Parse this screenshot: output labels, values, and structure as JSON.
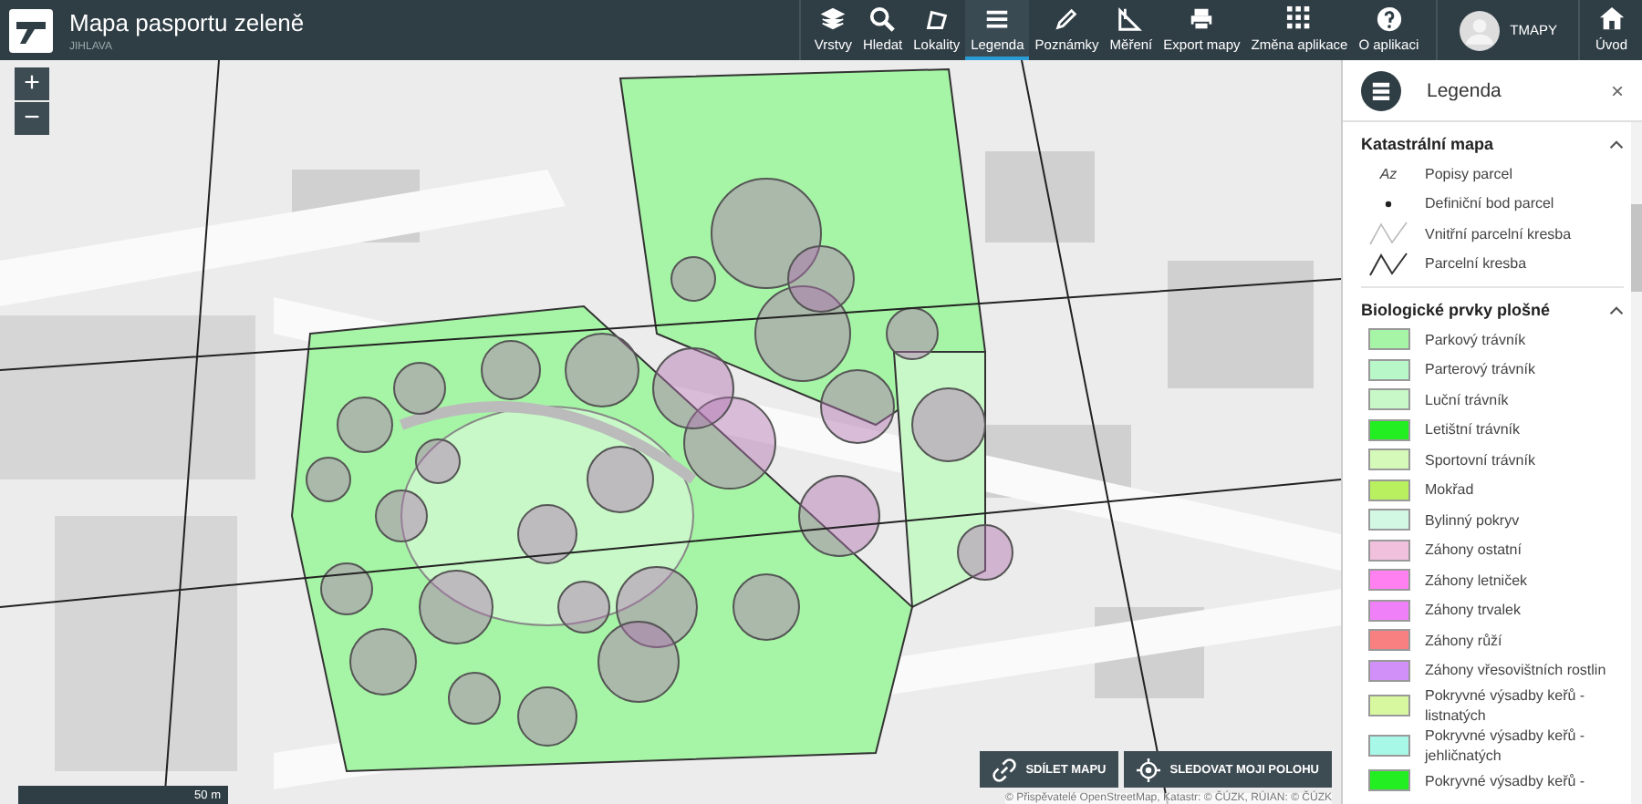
{
  "header": {
    "title": "Mapa pasportu zeleně",
    "subtitle": "JIHLAVA"
  },
  "toolbar": [
    {
      "label": "Vrstvy",
      "selected": false
    },
    {
      "label": "Hledat",
      "selected": false
    },
    {
      "label": "Lokality",
      "selected": false
    },
    {
      "label": "Legenda",
      "selected": true
    },
    {
      "label": "Poznámky",
      "selected": false
    },
    {
      "label": "Měření",
      "selected": false
    },
    {
      "label": "Export mapy",
      "selected": false
    },
    {
      "label": "Změna aplikace",
      "selected": false
    },
    {
      "label": "O aplikaci",
      "selected": false
    }
  ],
  "user": {
    "name": "TMAPY"
  },
  "home": {
    "label": "Úvod"
  },
  "map": {
    "zoom_in": "+",
    "zoom_out": "−",
    "scale": "50 m",
    "share_button": "SDÍLET MAPU",
    "locate_button": "SLEDOVAT MOJI POLOHU",
    "attribution": "© Přispěvatelé OpenStreetMap, Katastr: © ČÚZK, RÚIAN: © ČÚZK"
  },
  "legend": {
    "title": "Legenda",
    "close": "×",
    "sections": [
      {
        "title": "Katastrální mapa",
        "expanded": true,
        "items": [
          {
            "kind": "text",
            "symbol": "Az",
            "label": "Popisy parcel"
          },
          {
            "kind": "dot",
            "label": "Definiční bod parcel"
          },
          {
            "kind": "thin-line",
            "label": "Vnitřní parcelní kresba"
          },
          {
            "kind": "line",
            "label": "Parcelní kresba"
          }
        ]
      },
      {
        "title": "Biologické prvky plošné",
        "expanded": true,
        "items": [
          {
            "kind": "swatch",
            "color": "#a6f5a6",
            "label": "Parkový trávník"
          },
          {
            "kind": "swatch",
            "color": "#b8f7c8",
            "label": "Parterový trávník"
          },
          {
            "kind": "swatch",
            "color": "#c8f8c8",
            "label": "Luční trávník"
          },
          {
            "kind": "swatch",
            "color": "#22ee22",
            "label": "Letištní trávník"
          },
          {
            "kind": "swatch",
            "color": "#d4f9b8",
            "label": "Sportovní trávník"
          },
          {
            "kind": "swatch",
            "color": "#b8f060",
            "label": "Mokřad"
          },
          {
            "kind": "swatch",
            "color": "#d2f8e4",
            "label": "Bylinný pokryv"
          },
          {
            "kind": "swatch",
            "color": "#f0c0dc",
            "label": "Záhony ostatní"
          },
          {
            "kind": "swatch",
            "color": "#ff80f0",
            "label": "Záhony letniček"
          },
          {
            "kind": "swatch",
            "color": "#f080f8",
            "label": "Záhony trvalek"
          },
          {
            "kind": "swatch",
            "color": "#f88080",
            "label": "Záhony růží"
          },
          {
            "kind": "swatch",
            "color": "#d090f8",
            "label": "Záhony vřesovištních rostlin"
          },
          {
            "kind": "swatch",
            "color": "#d8f8a0",
            "label": "Pokryvné výsadby keřů - listnatých"
          },
          {
            "kind": "swatch",
            "color": "#a8f8e8",
            "label": "Pokryvné výsadby keřů - jehličnatých"
          },
          {
            "kind": "swatch",
            "color": "#22ee22",
            "label": "Pokryvné výsadby keřů -"
          }
        ]
      }
    ]
  }
}
